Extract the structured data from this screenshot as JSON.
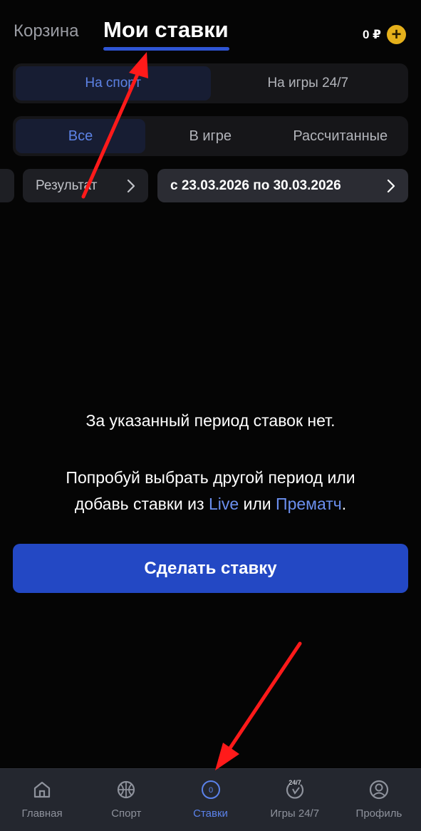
{
  "header": {
    "tab_cart": "Корзина",
    "tab_my_bets": "Мои ставки",
    "balance": "0 ₽",
    "plus_symbol": "+"
  },
  "segment_type": {
    "options": [
      "На спорт",
      "На игры 24/7"
    ],
    "selected": "На спорт"
  },
  "segment_status": {
    "options": [
      "Все",
      "В игре",
      "Рассчитанные"
    ],
    "selected": "Все"
  },
  "filters": {
    "result_label": "Результат",
    "date_range": "с 23.03.2026 по 30.03.2026"
  },
  "empty_state": {
    "title": "За указанный период ставок нет.",
    "text_line1": "Попробуй выбрать другой период или",
    "text_line2_prefix": "добавь ставки из",
    "link_live": "Live",
    "text_middle": "или",
    "link_prematch": "Прематч",
    "text_end": "."
  },
  "cta": {
    "label": "Сделать ставку"
  },
  "bottom_nav": {
    "items": [
      {
        "label": "Главная",
        "icon": "home-icon"
      },
      {
        "label": "Спорт",
        "icon": "basketball-icon"
      },
      {
        "label": "Ставки",
        "icon": "bets-counter-icon",
        "badge": "0"
      },
      {
        "label": "Игры 24/7",
        "icon": "games-24-7-icon",
        "badge": "24/7"
      },
      {
        "label": "Профиль",
        "icon": "profile-icon"
      }
    ],
    "active": "Ставки"
  },
  "colors": {
    "accent": "#2f55d4",
    "link": "#6b8fef",
    "coin": "#e5b01b",
    "annotation_arrow": "#ff1a1a"
  }
}
